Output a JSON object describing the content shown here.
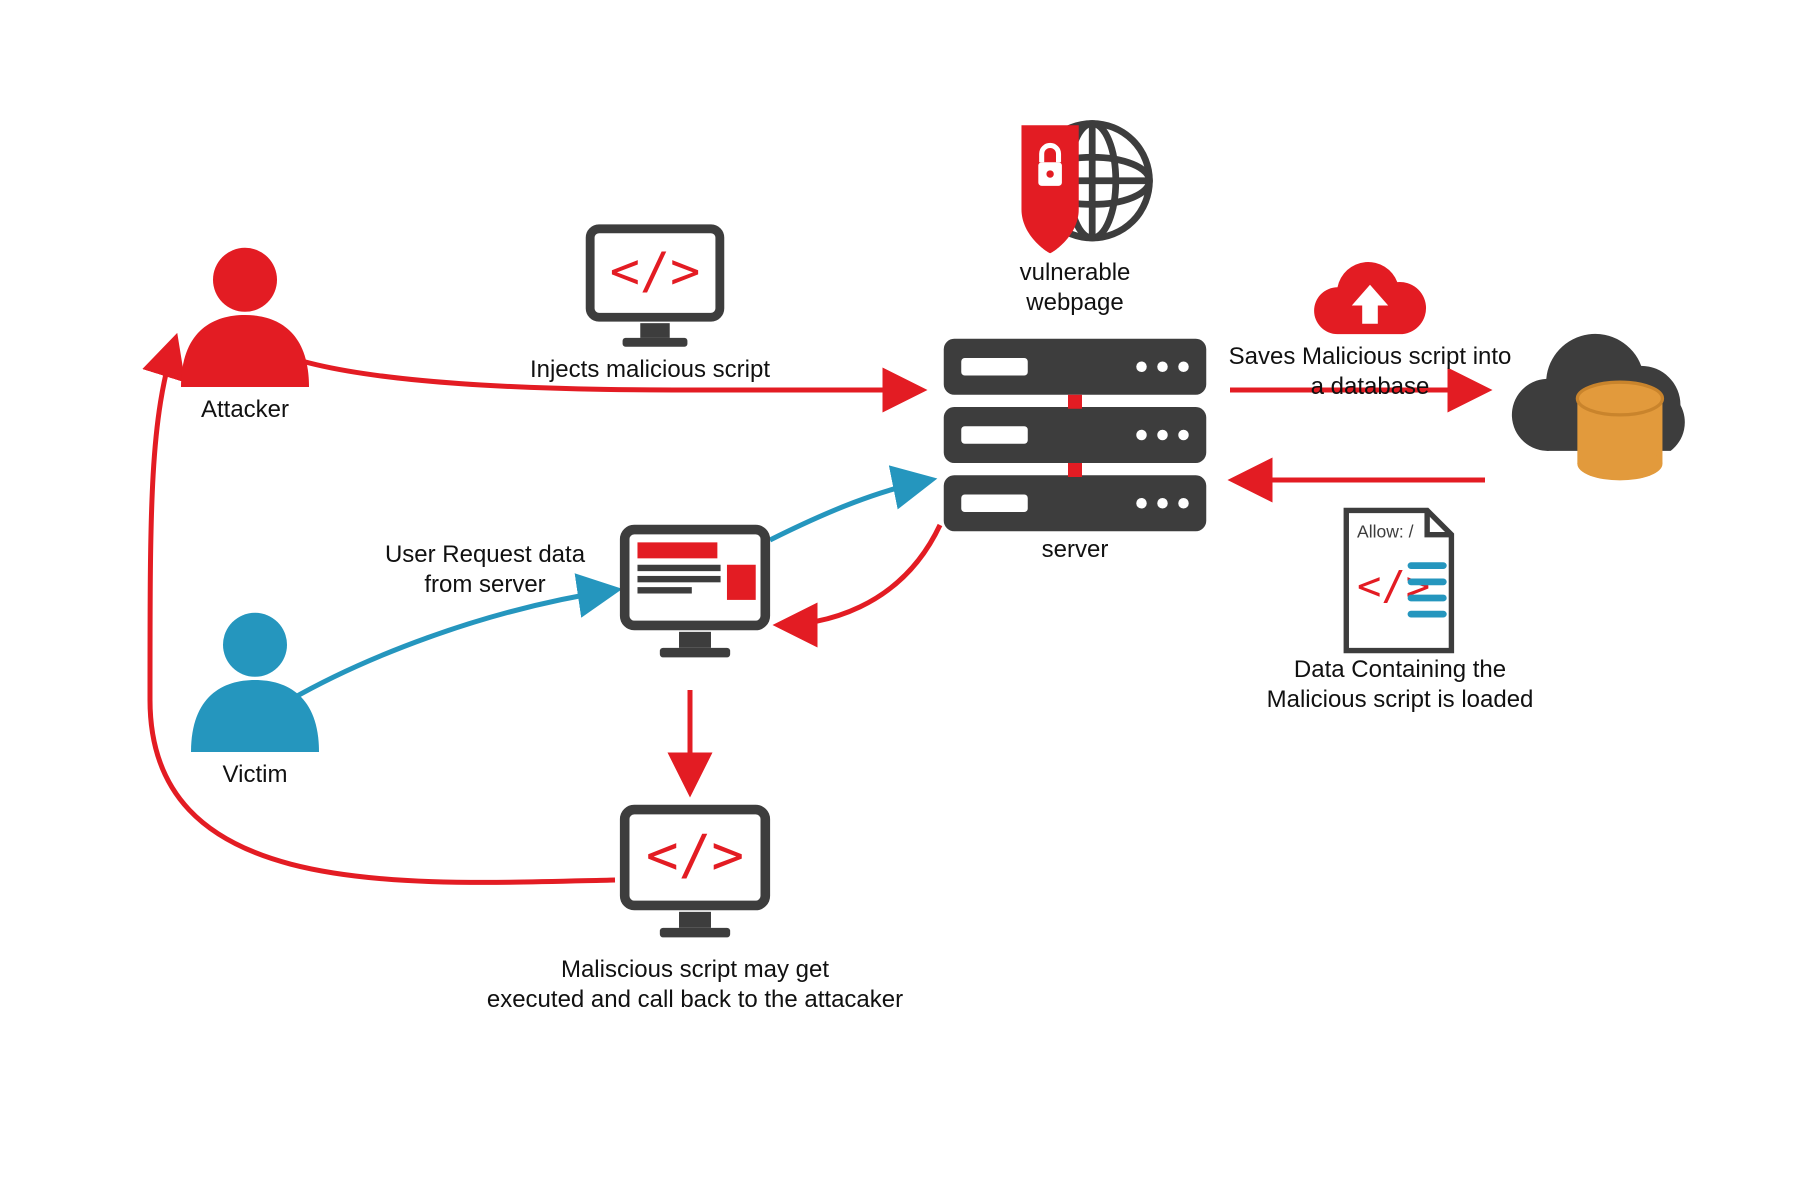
{
  "colors": {
    "red": "#e31c23",
    "blue": "#2596be",
    "dark": "#3d3d3d",
    "orange": "#e29a3c",
    "text": "#111111"
  },
  "nodes": {
    "attacker": {
      "label": "Attacker"
    },
    "victim": {
      "label": "Victim"
    },
    "vulnerable": {
      "label": "vulnerable\nwebpage"
    },
    "server": {
      "label": "server"
    },
    "save_db": {
      "label": "Saves Malicious script into\na database"
    },
    "data_load": {
      "label": "Data Containing the\nMalicious script is loaded"
    },
    "allow_file": {
      "label": "Allow: /"
    }
  },
  "edges": {
    "inject": {
      "label": "Injects malicious script"
    },
    "user_request": {
      "label": "User Request data\nfrom server"
    },
    "exec_callback": {
      "label": "Maliscious script may get\nexecuted and call back to the attacaker"
    }
  }
}
